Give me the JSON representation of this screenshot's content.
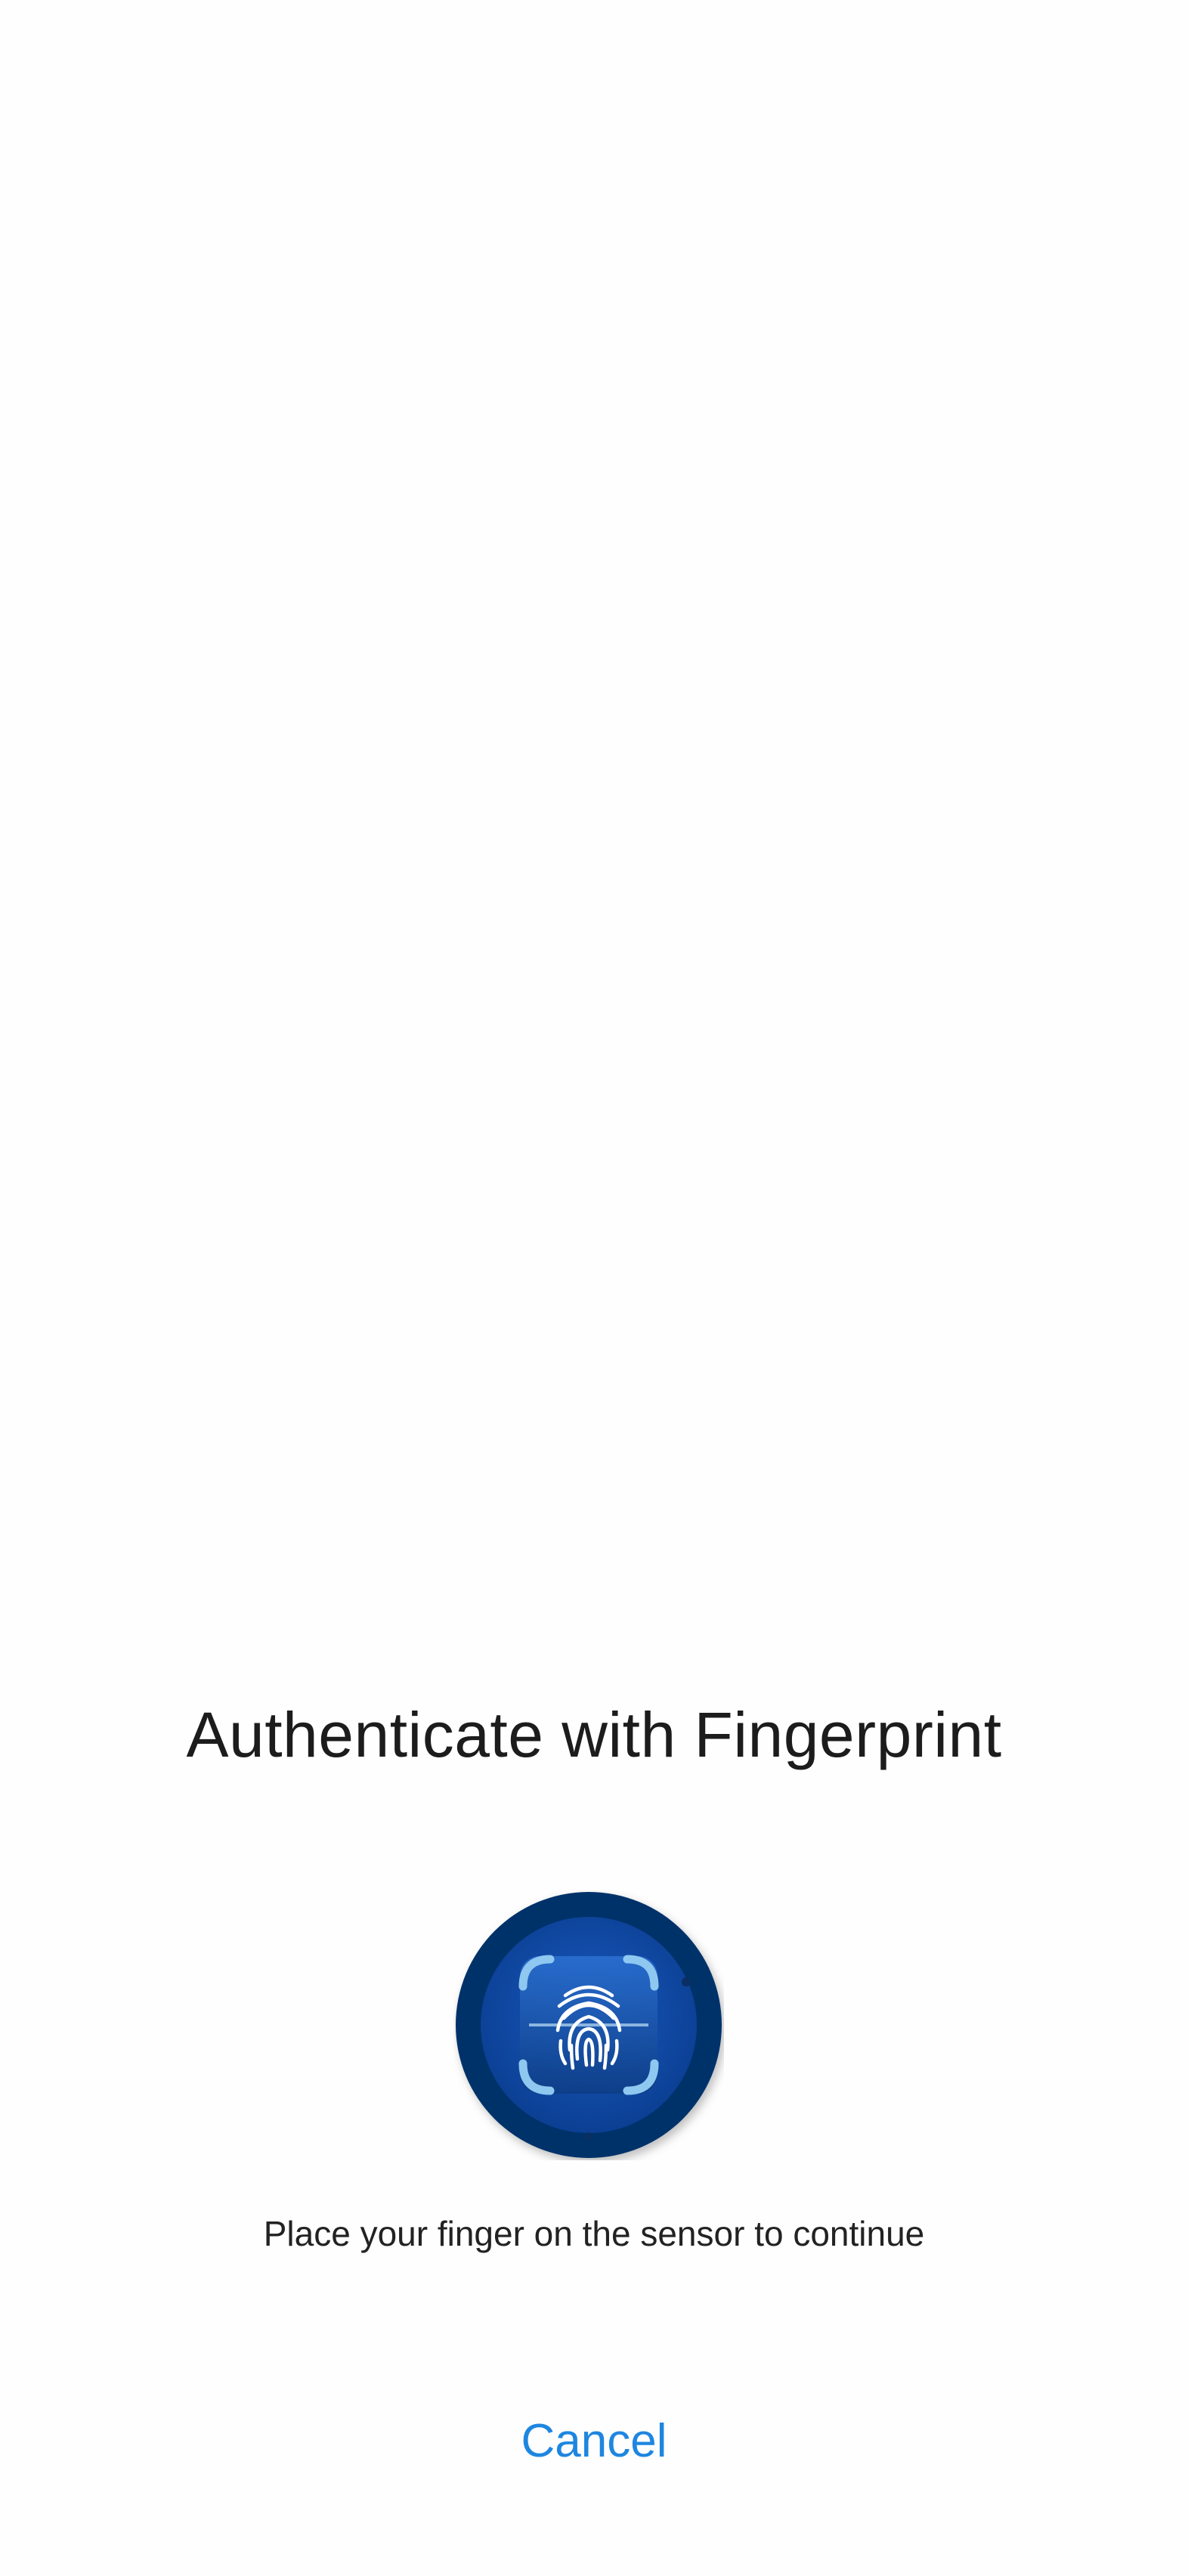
{
  "dialog": {
    "title": "Authenticate with Fingerprint",
    "hint": "Place your finger on the sensor to continue",
    "cancel_label": "Cancel",
    "sensor_icon": "fingerprint-icon"
  },
  "colors": {
    "accent": "#1e86e0",
    "sensor_outer": "#03336b",
    "sensor_inner": "#0a46a0",
    "text": "#1c1c1c"
  }
}
